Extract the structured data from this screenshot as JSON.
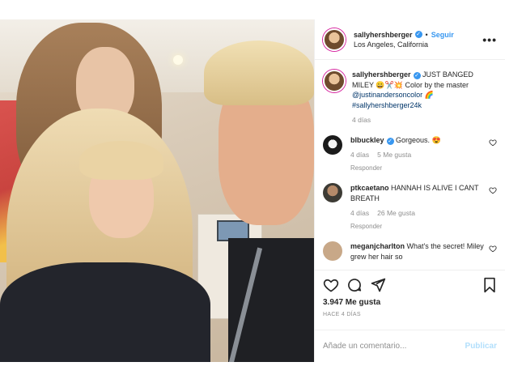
{
  "post": {
    "username": "sallyhershberger",
    "follow_label": "Seguir",
    "separator": "•",
    "location": "Los Angeles, California",
    "more_label": "•••"
  },
  "caption": {
    "username": "sallyhershberger",
    "text_a": " JUST BANGED MILEY 😀✂️💥 Color by the master ",
    "mention": "@justinandersoncolor",
    "text_b": " 🌈 ",
    "hashtag": "#sallyhershberger24k",
    "time": "4 días"
  },
  "comments": [
    {
      "username": "blbuckley",
      "text": " Gorgeous. 😍",
      "time": "4 días",
      "likes": "5 Me gusta",
      "reply": "Responder"
    },
    {
      "username": "ptkcaetano",
      "text": " HANNAH IS ALIVE I CANT BREATH",
      "time": "4 días",
      "likes": "26 Me gusta",
      "reply": "Responder"
    },
    {
      "username": "meganjcharlton",
      "text": " What's the secret! Miley grew her hair so"
    }
  ],
  "actions": {
    "likes": "3.947 Me gusta",
    "ago": "HACE 4 DÍAS"
  },
  "add_comment": {
    "placeholder": "Añade un comentario...",
    "publish": "Publicar"
  },
  "colors": {
    "link": "#003569",
    "accent": "#3897f0",
    "muted": "#8e8e8e"
  },
  "icons": [
    "more-icon",
    "verified-icon",
    "heart-icon",
    "comment-icon",
    "share-icon",
    "bookmark-icon"
  ]
}
